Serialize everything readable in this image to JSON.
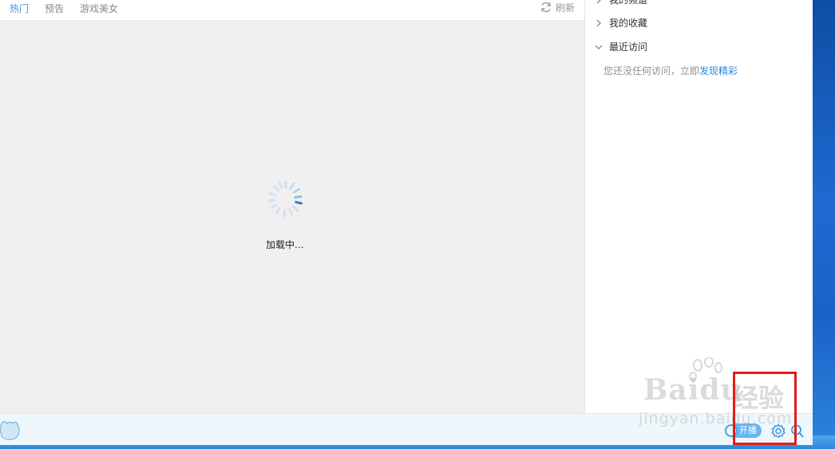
{
  "tabs": [
    {
      "label": "热门",
      "active": true
    },
    {
      "label": "预告",
      "active": false
    },
    {
      "label": "游戏美女",
      "active": false
    }
  ],
  "refresh": {
    "label": "刷新",
    "icon": "refresh-icon"
  },
  "main": {
    "loading_text": "加载中..."
  },
  "sidebar": {
    "items": [
      {
        "label": "我的频道",
        "expanded": false
      },
      {
        "label": "我的收藏",
        "expanded": false
      },
      {
        "label": "最近访问",
        "expanded": true
      }
    ],
    "recent_empty_text": "您还没任何访问，立即",
    "recent_empty_link": "发现精彩"
  },
  "bottom_bar": {
    "start_live_label": "开播",
    "settings_icon": "gear-icon",
    "search_icon": "search-icon"
  },
  "watermark": {
    "logo": "Baidu",
    "cn": "经验",
    "sub": "jingyan.baidu.com"
  },
  "colors": {
    "accent": "#3a97e6",
    "highlight": "#e21b1b",
    "content_bg": "#f0f0f0"
  }
}
